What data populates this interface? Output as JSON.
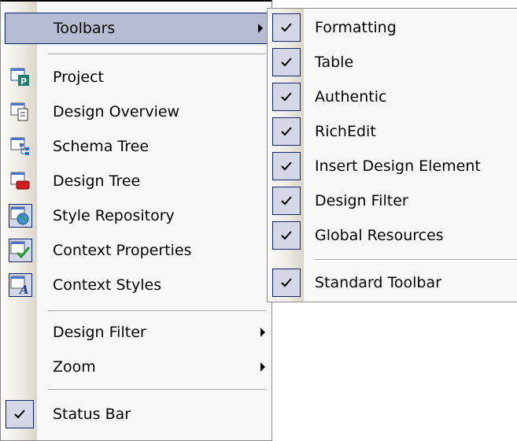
{
  "main_menu": {
    "toolbars_label": "Toolbars",
    "items": [
      {
        "label": "Project",
        "icon": "project-window-icon"
      },
      {
        "label": "Design Overview",
        "icon": "design-overview-icon"
      },
      {
        "label": "Schema Tree",
        "icon": "schema-tree-icon"
      },
      {
        "label": "Design Tree",
        "icon": "design-tree-icon"
      },
      {
        "label": "Style Repository",
        "icon": "style-repository-icon"
      },
      {
        "label": "Context Properties",
        "icon": "context-properties-icon"
      },
      {
        "label": "Context Styles",
        "icon": "context-styles-icon"
      }
    ],
    "design_filter_label": "Design Filter",
    "zoom_label": "Zoom",
    "status_bar_label": "Status Bar",
    "status_bar_checked": true
  },
  "toolbars_submenu": {
    "items": [
      {
        "label": "Formatting",
        "checked": true
      },
      {
        "label": "Table",
        "checked": true
      },
      {
        "label": "Authentic",
        "checked": true
      },
      {
        "label": "RichEdit",
        "checked": true
      },
      {
        "label": "Insert Design Element",
        "checked": true
      },
      {
        "label": "Design Filter",
        "checked": true
      },
      {
        "label": "Global Resources",
        "checked": true
      }
    ],
    "standard_toolbar_label": "Standard Toolbar",
    "standard_toolbar_checked": true
  },
  "colors": {
    "highlight_fill": "#b6bdd2",
    "highlight_border": "#0a246a",
    "check_fill": "#d4d8e6"
  }
}
